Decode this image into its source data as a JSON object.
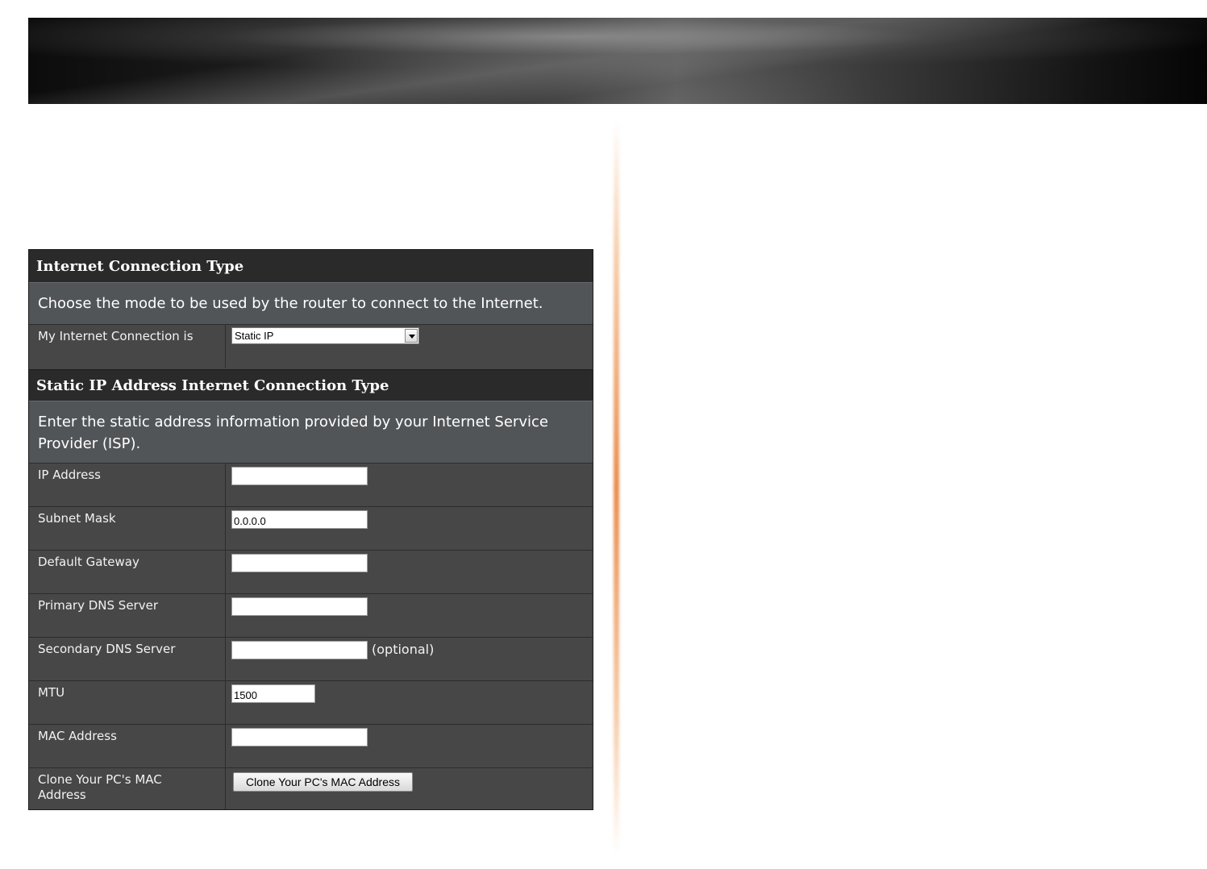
{
  "connection_section": {
    "title": "Internet Connection Type",
    "description": "Choose the mode to be used by the router to connect to the Internet.",
    "connection_label": "My Internet Connection is",
    "connection_value": "Static IP"
  },
  "static_section": {
    "title": "Static IP Address Internet Connection Type",
    "description": "Enter the static address information provided by your Internet Service Provider (ISP)."
  },
  "fields": {
    "ip_address": {
      "label": "IP Address",
      "value": ""
    },
    "subnet_mask": {
      "label": "Subnet Mask",
      "value": "0.0.0.0"
    },
    "default_gateway": {
      "label": "Default Gateway",
      "value": ""
    },
    "primary_dns": {
      "label": "Primary DNS Server",
      "value": ""
    },
    "secondary_dns": {
      "label": "Secondary DNS Server",
      "value": "",
      "note": "(optional)"
    },
    "mtu": {
      "label": "MTU",
      "value": "1500"
    },
    "mac_address": {
      "label": "MAC Address",
      "value": ""
    },
    "clone_mac": {
      "label": "Clone Your PC's MAC Address",
      "button_label": "Clone Your PC's MAC Address"
    }
  },
  "colors": {
    "header_bg": "#2a2a2a",
    "description_bg": "#525558",
    "row_bg": "#474747",
    "divider_accent": "#e8823c"
  }
}
